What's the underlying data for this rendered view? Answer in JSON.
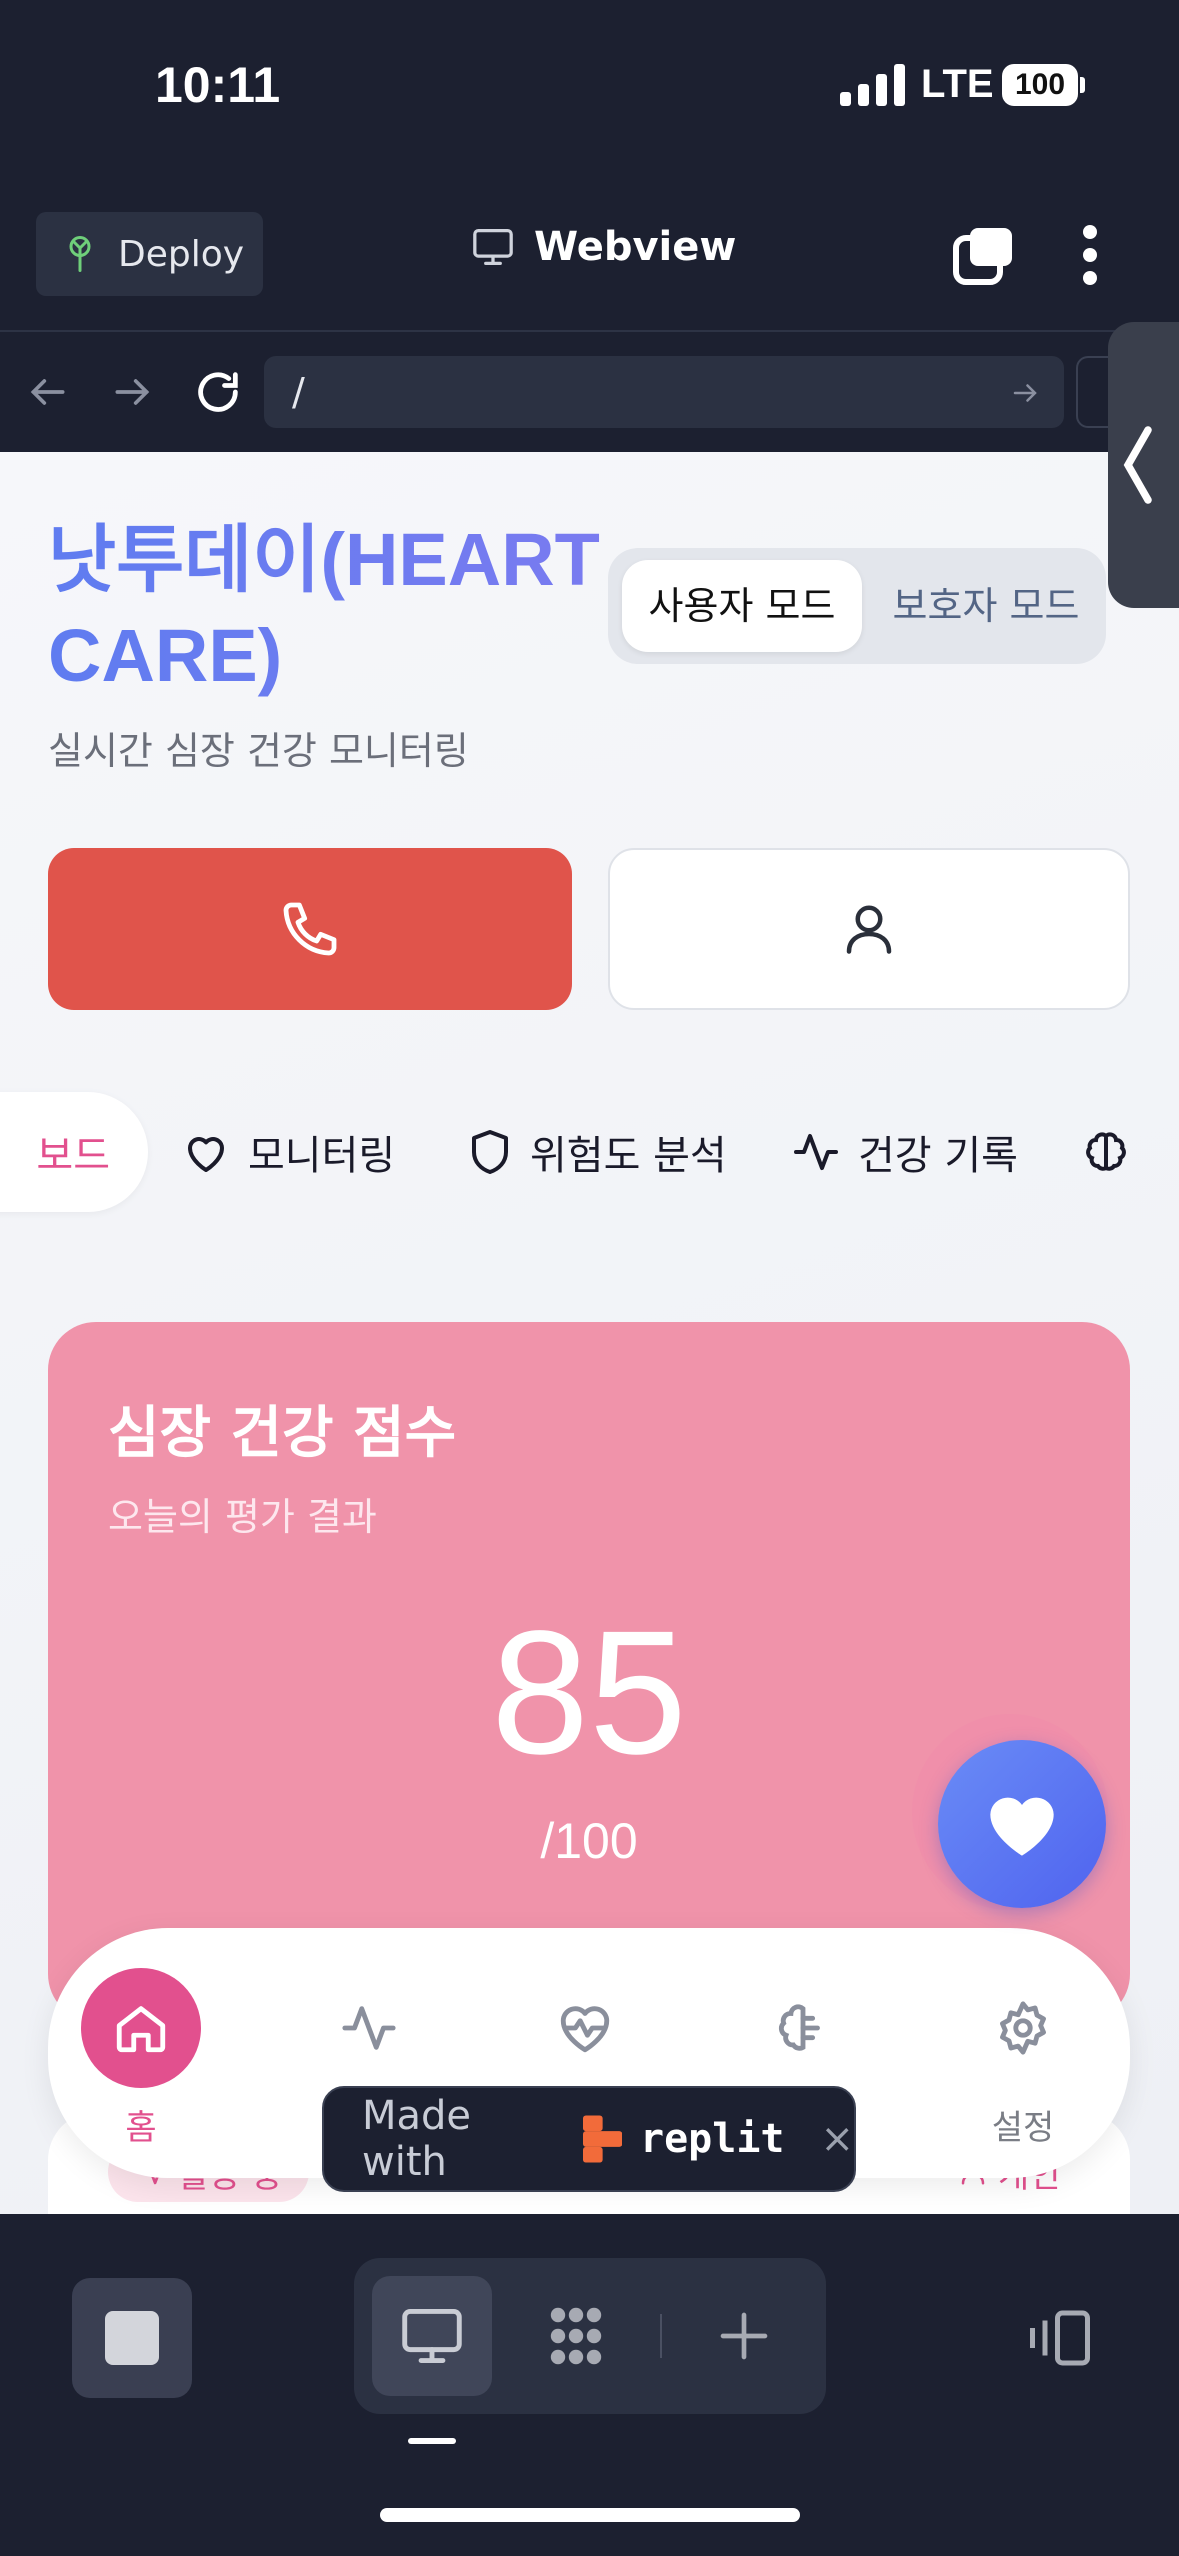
{
  "status_bar": {
    "time": "10:11",
    "network": "LTE",
    "battery": "100"
  },
  "toolbar": {
    "deploy_label": "Deploy",
    "webview_label": "Webview"
  },
  "url_bar": {
    "path": "/"
  },
  "app": {
    "title": "낫투데이(HEART CARE)",
    "subtitle": "실시간 심장 건강 모니터링",
    "modes": {
      "user": "사용자 모드",
      "guardian": "보호자 모드",
      "selected": "user"
    }
  },
  "tabs": [
    {
      "label": "보드",
      "icon": "dashboard-icon",
      "active": true
    },
    {
      "label": "모니터링",
      "icon": "heart-outline-icon"
    },
    {
      "label": "위험도 분석",
      "icon": "shield-icon"
    },
    {
      "label": "건강 기록",
      "icon": "activity-icon"
    },
    {
      "label": "",
      "icon": "brain-icon"
    }
  ],
  "score_card": {
    "title": "심장 건강 점수",
    "subtitle": "오늘의 평가 결과",
    "value": "85",
    "max": "/100"
  },
  "status_badges": {
    "activity": "활동 중",
    "personal": "개인"
  },
  "bottom_nav": [
    {
      "label": "홈",
      "icon": "home-icon",
      "active": true
    },
    {
      "label": "",
      "icon": "activity-icon"
    },
    {
      "label": "",
      "icon": "heart-pulse-icon"
    },
    {
      "label": "",
      "icon": "brain-icon"
    },
    {
      "label": "설정",
      "icon": "gear-icon"
    }
  ],
  "replit_badge": {
    "made_with": "Made with",
    "brand": "replit",
    "close": "×"
  },
  "colors": {
    "accent_pink": "#e2508e",
    "score_card": "#f093aa",
    "call_red": "#e0544b",
    "title_blue": "#6b7ff2",
    "dark_bg": "#1c2030"
  }
}
